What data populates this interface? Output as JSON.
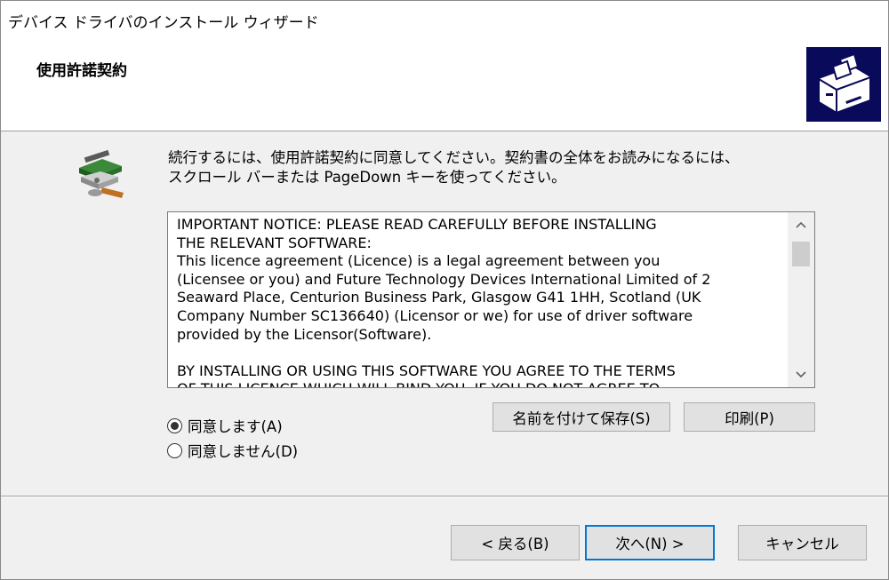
{
  "window": {
    "title": "デバイス ドライバのインストール ウィザード"
  },
  "header": {
    "title": "使用許諾契約",
    "icon": "installer-box-icon"
  },
  "intro": {
    "icon": "software-disc-icon",
    "text_line1": "続行するには、使用許諾契約に同意してください。契約書の全体をお読みになるには、",
    "text_line2": "スクロール バーまたは PageDown キーを使ってください。"
  },
  "license": {
    "text": "IMPORTANT NOTICE: PLEASE READ CAREFULLY BEFORE INSTALLING\nTHE RELEVANT SOFTWARE:\nThis licence agreement (Licence) is a legal agreement between you\n(Licensee or you) and Future Technology Devices International Limited of 2\nSeaward Place, Centurion Business Park, Glasgow G41 1HH, Scotland (UK\nCompany Number SC136640) (Licensor or we) for use of driver software\nprovided by the Licensor(Software).\n\nBY INSTALLING OR USING THIS SOFTWARE YOU AGREE TO THE TERMS\nOF THIS LICENCE WHICH WILL BIND YOU. IF YOU DO NOT AGREE TO",
    "scroll_up": "˄",
    "scroll_down": "˅"
  },
  "options": {
    "accept_label": "同意します(A)",
    "decline_label": "同意しません(D)",
    "selected": "accept"
  },
  "actions": {
    "save_label": "名前を付けて保存(S)",
    "print_label": "印刷(P)"
  },
  "footer": {
    "back_label": "< 戻る(B)",
    "next_label": "次へ(N) >",
    "cancel_label": "キャンセル"
  },
  "colors": {
    "header_icon_bg": "#0a0a5a",
    "default_button_border": "#0078d7"
  }
}
